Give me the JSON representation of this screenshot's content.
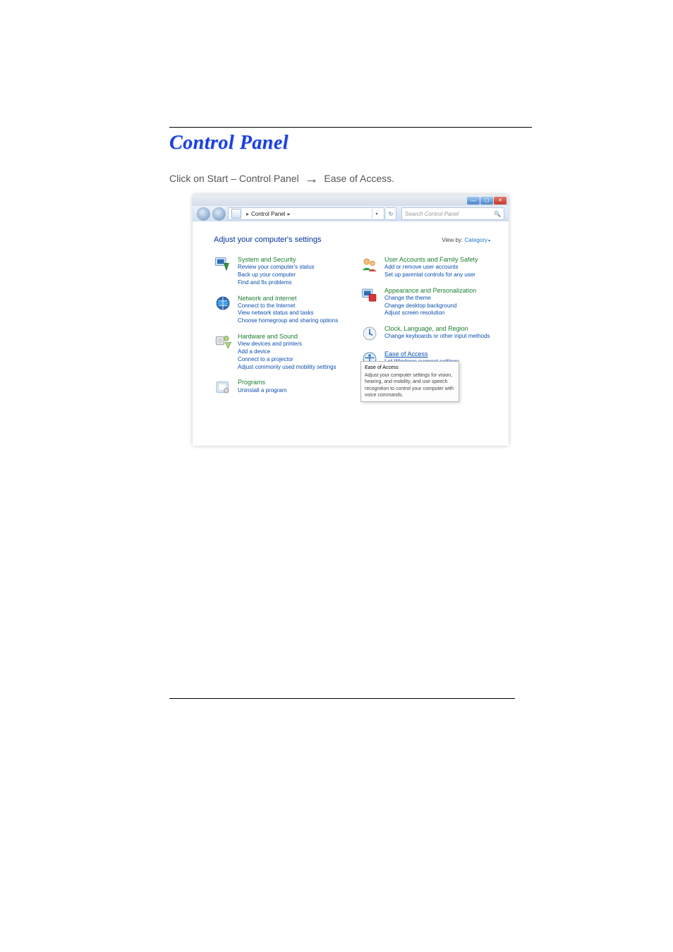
{
  "document": {
    "title": "Control Panel",
    "instruction_prefix": "Click on Start – Control Panel",
    "instruction_arrow": "→",
    "instruction_suffix": "Ease of Access.",
    "page_number": ""
  },
  "window": {
    "titlebar": {
      "min": "—",
      "max": "▢",
      "close": "✕"
    },
    "address": {
      "back": "back",
      "forward": "forward",
      "breadcrumb_sep": "▸",
      "breadcrumb_text": "Control Panel",
      "dropdown": "▾",
      "refresh": "↻"
    },
    "search": {
      "placeholder": "Search Control Panel",
      "icon": "🔍"
    },
    "heading": "Adjust your computer's settings",
    "viewby": {
      "label": "View by:",
      "value": "Category",
      "caret": "▾"
    }
  },
  "categories": {
    "left": [
      {
        "id": "system",
        "title": "System and Security",
        "links": [
          "Review your computer's status",
          "Back up your computer",
          "Find and fix problems"
        ]
      },
      {
        "id": "network",
        "title": "Network and Internet",
        "links": [
          "Connect to the Internet",
          "View network status and tasks",
          "Choose homegroup and sharing options"
        ]
      },
      {
        "id": "hardware",
        "title": "Hardware and Sound",
        "links": [
          "View devices and printers",
          "Add a device",
          "Connect to a projector",
          "Adjust commonly used mobility settings"
        ]
      },
      {
        "id": "programs",
        "title": "Programs",
        "links": [
          "Uninstall a program"
        ]
      }
    ],
    "right": [
      {
        "id": "users",
        "title": "User Accounts and Family Safety",
        "links": [
          "Add or remove user accounts",
          "Set up parental controls for any user"
        ]
      },
      {
        "id": "appearance",
        "title": "Appearance and Personalization",
        "links": [
          "Change the theme",
          "Change desktop background",
          "Adjust screen resolution"
        ]
      },
      {
        "id": "clock",
        "title": "Clock, Language, and Region",
        "links": [
          "Change keyboards or other input methods"
        ]
      },
      {
        "id": "ease",
        "title": "Ease of Access",
        "links": [
          "Let Windows suggest settings"
        ]
      }
    ]
  },
  "tooltip": {
    "title": "Ease of Access",
    "body": "Adjust your computer settings for vision, hearing, and mobility, and use speech recognition to control your computer with voice commands."
  }
}
